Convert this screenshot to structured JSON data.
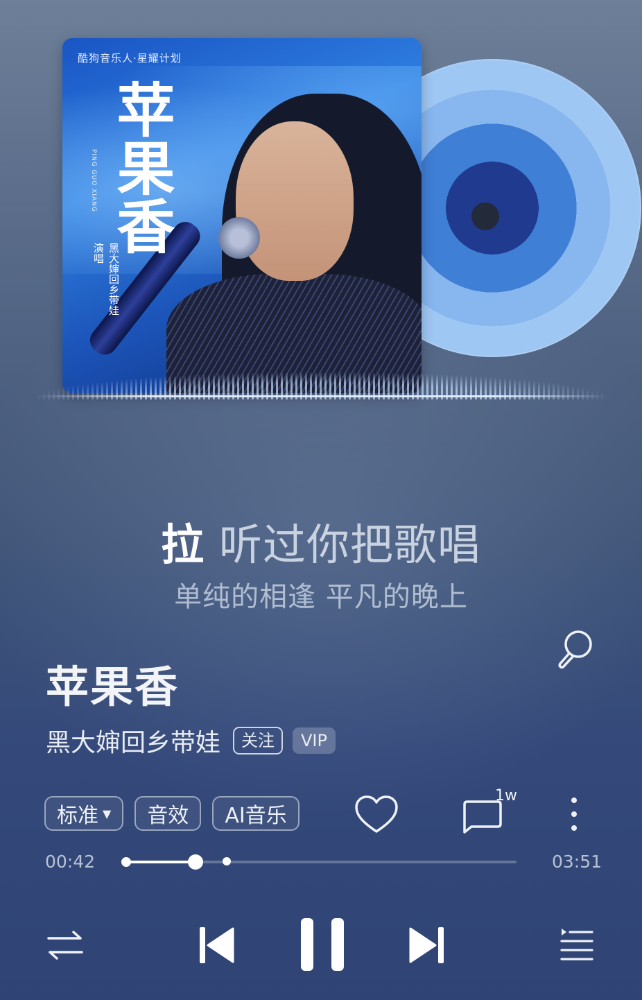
{
  "album": {
    "tagline": "酷狗音乐人·星耀计划",
    "title": "苹果香",
    "pinyin": "PING GUO XIANG",
    "singer_label": "演唱",
    "artist": "黑大婶回乡带娃"
  },
  "lyrics": {
    "current_sung": "拉",
    "current_rest": "听过你把歌唱",
    "next": "单纯的相逢 平凡的晚上"
  },
  "song": {
    "title": "苹果香",
    "artist": "黑大婶回乡带娃",
    "follow_label": "关注",
    "vip_label": "VIP"
  },
  "actions": {
    "quality_label": "标准",
    "effects_label": "音效",
    "ai_label": "AI音乐",
    "comment_count": "1w",
    "icons": [
      "karaoke-mic-icon",
      "heart-icon",
      "comment-icon",
      "more-icon"
    ]
  },
  "progress": {
    "current_time": "00:42",
    "total_time": "03:51",
    "played_fraction": 0.18,
    "buffered_fraction": 0.26
  },
  "controls": {
    "icons": [
      "loop-icon",
      "previous-icon",
      "pause-icon",
      "next-icon",
      "playlist-icon"
    ]
  },
  "colors": {
    "background_top": "#6e7f99",
    "background_bottom": "#2f4475",
    "cover_blue": "#1a55c4",
    "vinyl_blue": "#9fc7f3"
  }
}
